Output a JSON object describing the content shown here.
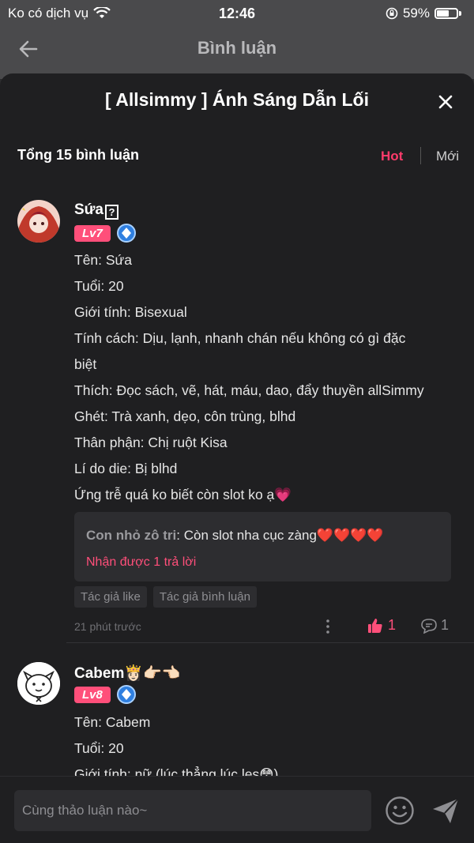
{
  "status_bar": {
    "carrier": "Ko có dịch vụ",
    "time": "12:46",
    "battery": "59%"
  },
  "nav": {
    "title": "Bình luận"
  },
  "sheet": {
    "title": "[ Allsimmy ] Ánh Sáng Dẫn Lối",
    "summary": "Tổng 15 bình luận",
    "sort_hot": "Hot",
    "sort_new": "Mới"
  },
  "comments": [
    {
      "name": "Sứa",
      "level": "Lv7",
      "lines": [
        "Tên: Sứa",
        "Tuổi: 20",
        "Giới tính: Bisexual",
        "Tính cách: Dịu, lạnh, nhanh chán nếu không có gì đặc",
        "biệt",
        "Thích: Đọc sách, vẽ, hát, máu, dao, đẩy thuyền allSimmy",
        "Ghét: Trà xanh, dẹo, côn trùng, blhd",
        "Thân phận: Chị ruột Kisa",
        "Lí do die: Bị blhd",
        "Ứng trễ quá ko biết còn slot ko ạ💗"
      ],
      "reply_author": "Con nhỏ zô tri",
      "reply_text": ": Còn slot nha cục zàng❤️❤️❤️❤️",
      "reply_more": "Nhận được 1 trả lời",
      "tags": [
        "Tác giả like",
        "Tác giả bình luận"
      ],
      "time": "21 phút trước",
      "likes": "1",
      "replies": "1"
    },
    {
      "name": "Cabem👸🏻👉🏻👈🏻",
      "level": "Lv8",
      "lines": [
        "Tên: Cabem",
        "Tuổi: 20",
        "Giới tính: nữ (lúc thẳng lúc les😳)"
      ]
    }
  ],
  "input": {
    "placeholder": "Cùng thảo luận nào~"
  },
  "colors": {
    "accent": "#ff4f7a",
    "background": "#1f1f21"
  }
}
